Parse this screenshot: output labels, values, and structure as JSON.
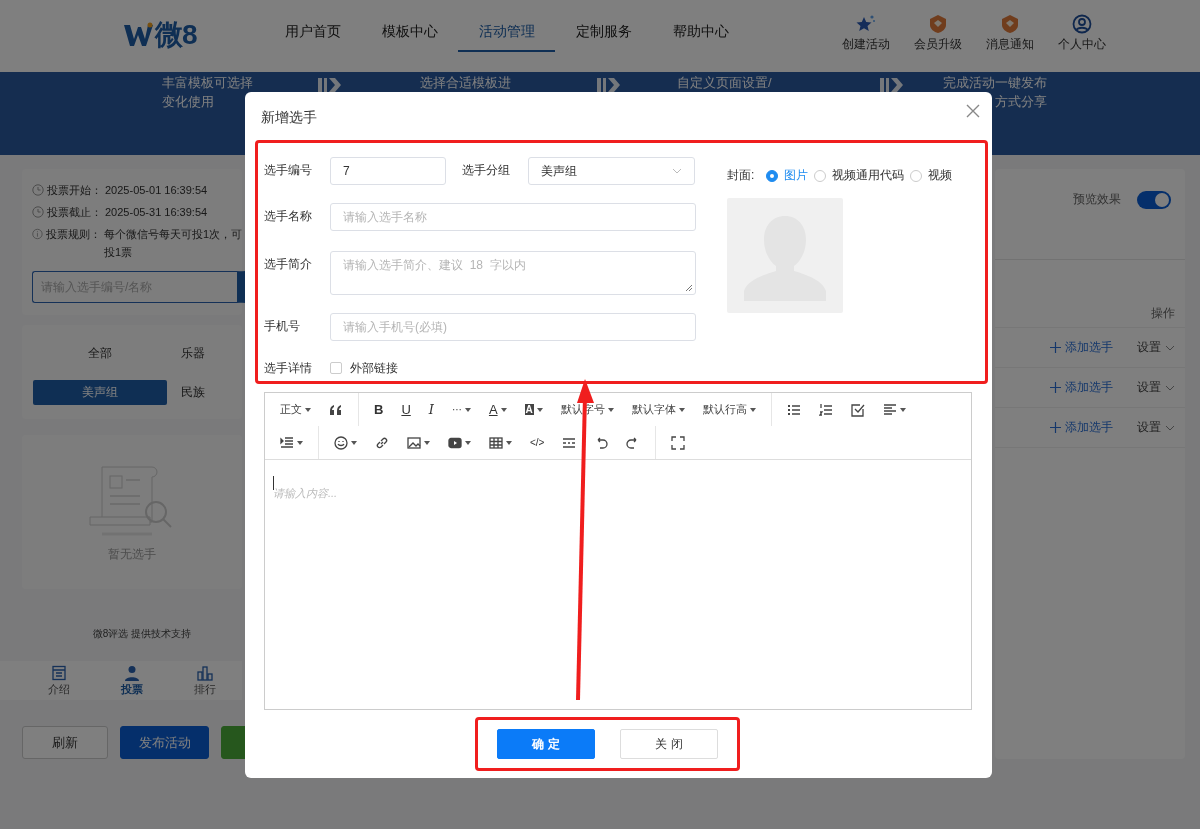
{
  "header": {
    "logo": "微8",
    "nav": [
      {
        "label": "用户首页",
        "selected": false
      },
      {
        "label": "模板中心",
        "selected": false
      },
      {
        "label": "活动管理",
        "selected": true
      },
      {
        "label": "定制服务",
        "selected": false
      },
      {
        "label": "帮助中心",
        "selected": false
      }
    ],
    "actions": [
      {
        "label": "创建活动",
        "kind": "star"
      },
      {
        "label": "会员升级",
        "kind": "badge"
      },
      {
        "label": "消息通知",
        "kind": "badge"
      },
      {
        "label": "个人中心",
        "kind": "user"
      }
    ]
  },
  "banner_steps": [
    [
      "丰富模板可选择",
      "变化使用"
    ],
    [
      "选择合适模板进"
    ],
    [
      "自定义页面设置/"
    ],
    [
      "完成活动一键发布",
      "方式分享"
    ]
  ],
  "preview": {
    "info": [
      {
        "kind": "clock",
        "label": "投票开始：",
        "value": "2025-05-01 16:39:54"
      },
      {
        "kind": "clock",
        "label": "投票截止：",
        "value": "2025-05-31 16:39:54"
      },
      {
        "kind": "info",
        "label": "投票规则：",
        "value": "每个微信号每天可投1次，可",
        "more": "投1票"
      }
    ],
    "search_placeholder": "请输入选手编号/名称",
    "groups": [
      {
        "label": "全部",
        "selected": false
      },
      {
        "label": "乐器",
        "selected": false
      },
      {
        "label": "美声组",
        "selected": true
      },
      {
        "label": "民族",
        "selected": false
      }
    ],
    "empty_text": "暂无选手",
    "footer": "微8评选 提供技术支持",
    "tabs": [
      {
        "label": "介绍",
        "kind": "doc",
        "selected": false
      },
      {
        "label": "投票",
        "kind": "person",
        "selected": true
      },
      {
        "label": "排行",
        "kind": "chart",
        "selected": false
      }
    ]
  },
  "page_buttons": [
    {
      "label": "刷新",
      "kind": "plain"
    },
    {
      "label": "发布活动",
      "kind": "primary"
    },
    {
      "kind": "success"
    }
  ],
  "side": {
    "preview_label": "预览效果",
    "preview_on": true,
    "ops_header": "操作",
    "rows": [
      {
        "add": "添加选手",
        "settings": "设置"
      },
      {
        "add": "添加选手",
        "settings": "设置"
      },
      {
        "add": "添加选手",
        "settings": "设置"
      }
    ]
  },
  "dialog": {
    "title": "新增选手",
    "number": {
      "label": "选手编号",
      "value": "7"
    },
    "group": {
      "label": "选手分组",
      "value": "美声组"
    },
    "name": {
      "label": "选手名称",
      "placeholder": "请输入选手名称"
    },
    "intro": {
      "label": "选手简介",
      "placeholder": "请输入选手简介、建议  18  字以内"
    },
    "phone": {
      "label": "手机号",
      "placeholder": "请输入手机号(必填)"
    },
    "detail": {
      "label": "选手详情",
      "checkbox": "外部链接",
      "checked": false
    },
    "cover": {
      "label": "封面:",
      "options": [
        {
          "label": "图片",
          "selected": true
        },
        {
          "label": "视频通用代码",
          "selected": false
        },
        {
          "label": "视频",
          "selected": false
        }
      ]
    },
    "toolbar": [
      [
        [
          {
            "kind": "text",
            "label": "正文",
            "caret": true
          },
          {
            "kind": "quote",
            "caret": false
          }
        ],
        [
          {
            "kind": "bold",
            "label": "B",
            "caret": false
          },
          {
            "kind": "underline",
            "label": "U",
            "caret": false
          },
          {
            "kind": "italic",
            "label": "I",
            "caret": false
          },
          {
            "kind": "more",
            "label": "···",
            "caret": true
          },
          {
            "kind": "font-color",
            "label": "A",
            "caret": true
          },
          {
            "kind": "back-color",
            "label": "A",
            "caret": true
          },
          {
            "kind": "text",
            "label": "默认字号",
            "caret": true
          },
          {
            "kind": "text",
            "label": "默认字体",
            "caret": true
          },
          {
            "kind": "text",
            "label": "默认行高",
            "caret": true
          }
        ],
        [
          {
            "kind": "bullets",
            "caret": false
          },
          {
            "kind": "numbers",
            "caret": false
          },
          {
            "kind": "todo",
            "caret": false
          },
          {
            "kind": "align",
            "caret": true
          }
        ]
      ],
      [
        [
          {
            "kind": "indent",
            "caret": true
          }
        ],
        [
          {
            "kind": "emoji",
            "caret": true
          },
          {
            "kind": "link",
            "caret": false
          },
          {
            "kind": "image",
            "caret": true
          },
          {
            "kind": "video",
            "caret": true
          },
          {
            "kind": "table",
            "caret": true
          },
          {
            "kind": "code",
            "label": "</>",
            "caret": false
          },
          {
            "kind": "rule",
            "caret": false
          },
          {
            "kind": "undo",
            "caret": false
          },
          {
            "kind": "redo",
            "caret": false
          }
        ],
        [
          {
            "kind": "fullscreen",
            "caret": false
          }
        ]
      ]
    ],
    "editor_placeholder": "请输入内容...",
    "buttons": [
      {
        "label": "确 定",
        "kind": "primary"
      },
      {
        "label": "关 闭",
        "kind": "plain"
      }
    ]
  }
}
